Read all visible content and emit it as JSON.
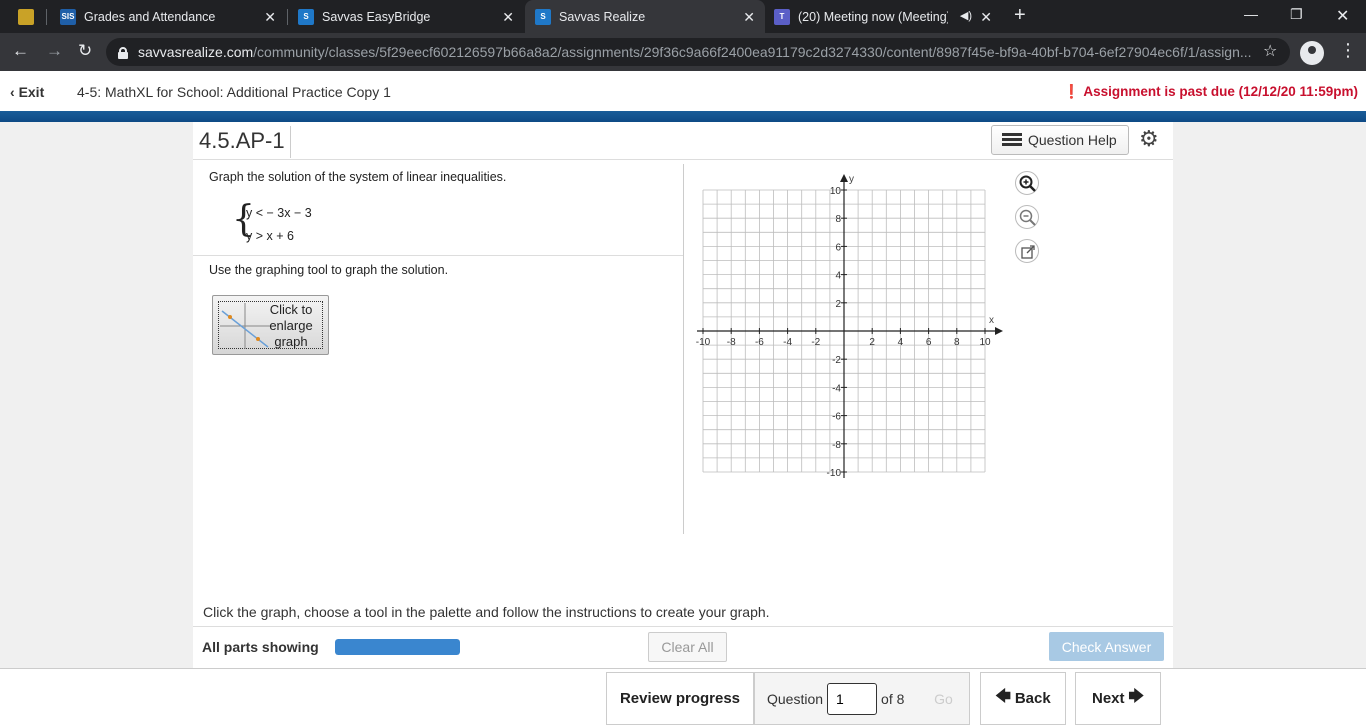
{
  "browser": {
    "tabs": [
      {
        "label": "",
        "icon": "generic-favicon"
      },
      {
        "label": "Grades and Attendance",
        "icon": "sis-favicon"
      },
      {
        "label": "Savvas EasyBridge",
        "icon": "savvas-favicon"
      },
      {
        "label": "Savvas Realize",
        "icon": "savvas-favicon"
      },
      {
        "label": "(20) Meeting now (Meeting)",
        "icon": "teams-favicon"
      }
    ],
    "sis_badge": "SIS",
    "url_host": "savvasrealize.com",
    "url_path": "/community/classes/5f29eecf602126597b66a8a2/assignments/29f36c9a66f2400ea91179c2d3274330/content/8987f45e-bf9a-40bf-b704-6ef27904ec6f/1/assign..."
  },
  "header": {
    "exit_label": "Exit",
    "title": "4-5: MathXL for School: Additional Practice Copy 1",
    "past_due": "Assignment is past due (12/12/20 11:59pm)"
  },
  "question": {
    "id": "4.5.AP-1",
    "help_label": "Question Help",
    "prompt": "Graph the solution of the system of linear inequalities.",
    "inequality_1": "y < − 3x − 3",
    "inequality_2": "y > x + 6",
    "instruction": "Use the graphing tool to graph the solution.",
    "enlarge_line1": "Click to",
    "enlarge_line2": "enlarge",
    "enlarge_line3": "graph",
    "graph_hint": "Click the graph, choose a tool in the palette and follow the instructions to create your graph."
  },
  "graph": {
    "x_label": "x",
    "y_label": "y",
    "x_ticks": [
      "-10",
      "-8",
      "-6",
      "-4",
      "-2",
      "2",
      "4",
      "6",
      "8",
      "10"
    ],
    "y_ticks": [
      "10",
      "8",
      "6",
      "4",
      "2",
      "-2",
      "-4",
      "-6",
      "-8",
      "-10"
    ]
  },
  "footer": {
    "all_parts": "All parts showing",
    "progress": 1.0,
    "clear_all": "Clear All",
    "check_answer": "Check Answer"
  },
  "nav": {
    "review": "Review progress",
    "question_label": "Question",
    "question_value": "1",
    "of_label": "of 8",
    "go": "Go",
    "back": "Back",
    "next": "Next"
  },
  "colors": {
    "past_due": "#c8102e",
    "blue_bar": "#1a5d99",
    "progress_fill": "#3a86cf",
    "check_answer_bg": "#a8c9e4"
  }
}
